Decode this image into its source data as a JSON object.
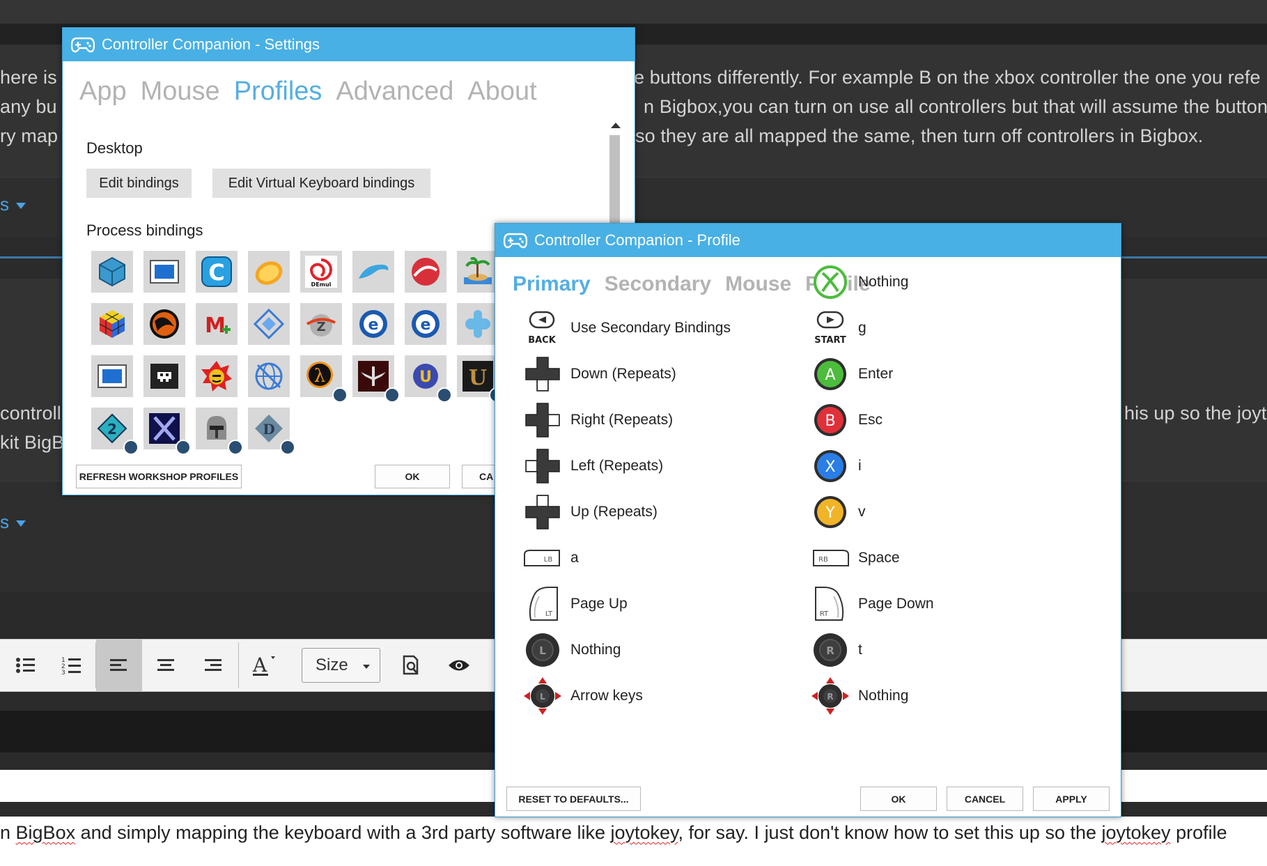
{
  "background": {
    "lines_top": [
      "here is t",
      "any bu",
      "ry map"
    ],
    "lines_right": [
      "e buttons differently. For example B on the xbox controller the one you refe",
      "n Bigbox,you can turn on use all controllers but that will assume the button",
      "so they are all mapped the same, then turn off controllers in Bigbox."
    ],
    "link1": "s",
    "link2": "s",
    "mid_left": [
      "controll",
      "kit BigBo"
    ],
    "mid_right": "his up so the joyto",
    "toolbar": {
      "size_label": "Size"
    },
    "bottom": {
      "p1": "n ",
      "w1": "BigBox",
      "p2": " and simply mapping the keyboard with a 3rd party software like ",
      "w2": "joytokey",
      "p3": ", for say. I just don't know how to set this up so the ",
      "w3": "joytokey",
      "p4": " profile"
    }
  },
  "settings": {
    "title": "Controller Companion - Settings",
    "tabs": [
      "App",
      "Mouse",
      "Profiles",
      "Advanced",
      "About"
    ],
    "active_tab": "Profiles",
    "desktop_label": "Desktop",
    "edit_bindings": "Edit bindings",
    "edit_vk_bindings": "Edit Virtual Keyboard bindings",
    "process_label": "Process bindings",
    "refresh_btn": "REFRESH WORKSHOP PROFILES",
    "ok_btn": "OK",
    "cancel_btn": "CA"
  },
  "profile": {
    "title": "Controller Companion - Profile",
    "tabs": [
      "Primary",
      "Secondary",
      "Mouse",
      "Profile"
    ],
    "active_tab": "Primary",
    "left": [
      {
        "icon": "back-button-icon",
        "icon_text": "BACK",
        "label": "Use Secondary Bindings"
      },
      {
        "icon": "dpad-down-icon",
        "label": "Down (Repeats)"
      },
      {
        "icon": "dpad-right-icon",
        "label": "Right (Repeats)"
      },
      {
        "icon": "dpad-left-icon",
        "label": "Left (Repeats)"
      },
      {
        "icon": "dpad-up-icon",
        "label": "Up (Repeats)"
      },
      {
        "icon": "lb-bumper-icon",
        "icon_text": "LB",
        "label": "a"
      },
      {
        "icon": "lt-trigger-icon",
        "icon_text": "LT",
        "label": "Page Up"
      },
      {
        "icon": "left-stick-click-icon",
        "icon_text": "L",
        "label": "Nothing"
      },
      {
        "icon": "left-stick-move-icon",
        "icon_text": "L",
        "label": "Arrow keys"
      }
    ],
    "right": [
      {
        "icon": "xbox-guide-icon",
        "label": "Nothing"
      },
      {
        "icon": "start-button-icon",
        "icon_text": "START",
        "label": "g"
      },
      {
        "icon": "a-button-icon",
        "icon_text": "A",
        "color": "#4cbc3c",
        "label": "Enter"
      },
      {
        "icon": "b-button-icon",
        "icon_text": "B",
        "color": "#e0303a",
        "label": "Esc"
      },
      {
        "icon": "x-button-icon",
        "icon_text": "X",
        "color": "#2a7ee6",
        "label": "i"
      },
      {
        "icon": "y-button-icon",
        "icon_text": "Y",
        "color": "#f0b428",
        "label": "v"
      },
      {
        "icon": "rb-bumper-icon",
        "icon_text": "RB",
        "label": "Space"
      },
      {
        "icon": "rt-trigger-icon",
        "icon_text": "RT",
        "label": "Page Down"
      },
      {
        "icon": "right-stick-click-icon",
        "icon_text": "R",
        "label": "t"
      },
      {
        "icon": "right-stick-move-icon",
        "icon_text": "R",
        "label": "Nothing"
      }
    ],
    "reset_btn": "RESET TO DEFAULTS...",
    "ok_btn": "OK",
    "cancel_btn": "CANCEL",
    "apply_btn": "APPLY"
  }
}
